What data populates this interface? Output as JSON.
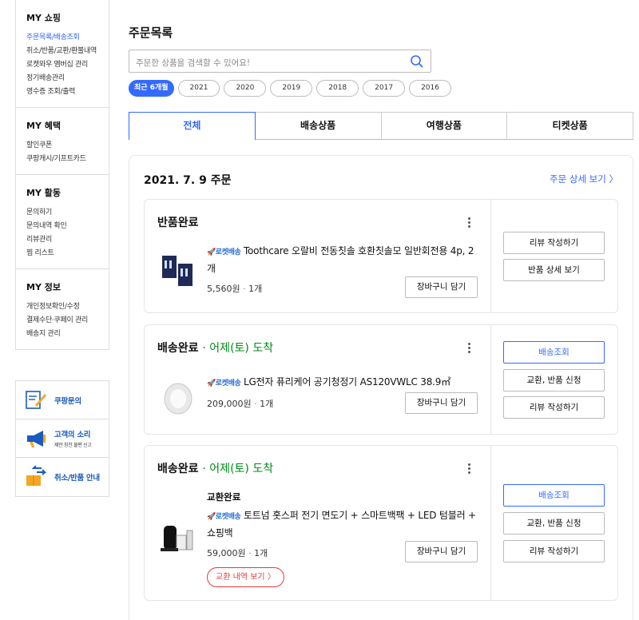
{
  "sidebar": {
    "sections": [
      {
        "title": "MY 쇼핑",
        "items": [
          "주문목록/배송조회",
          "취소/반품/교환/환불내역",
          "로켓와우 멤버십 관리",
          "정기배송관리",
          "영수증 조회/출력"
        ]
      },
      {
        "title": "MY 혜택",
        "items": [
          "할인쿠폰",
          "쿠팡캐시/기프트카드"
        ]
      },
      {
        "title": "MY 활동",
        "items": [
          "문의하기",
          "문의내역 확인",
          "리뷰관리",
          "찜 리스트"
        ]
      },
      {
        "title": "MY 정보",
        "items": [
          "개인정보확인/수정",
          "결제수단·쿠페이 관리",
          "배송지 관리"
        ]
      }
    ],
    "cards": [
      {
        "title": "쿠팡문의",
        "subtitle": "",
        "icon": "inquiry-icon"
      },
      {
        "title": "고객의 소리",
        "subtitle": "제안 칭찬 불편 신고",
        "icon": "megaphone-icon"
      },
      {
        "title": "취소/반품 안내",
        "subtitle": "",
        "icon": "box-return-icon"
      }
    ]
  },
  "main": {
    "title": "주문목록",
    "search_placeholder": "주문한 상품을 검색할 수 있어요!",
    "years": [
      "최근 6개월",
      "2021",
      "2020",
      "2019",
      "2018",
      "2017",
      "2016"
    ],
    "tabs": [
      "전체",
      "배송상품",
      "여행상품",
      "티켓상품"
    ],
    "order": {
      "date": "2021. 7. 9 주문",
      "detail_link": "주문 상세 보기 〉",
      "rocket_label": "🚀로켓배송",
      "cart_label": "장바구니 담기",
      "items": [
        {
          "status": "반품완료",
          "status_sub": "",
          "name": "Toothcare 오랄비 전동칫솔 호환칫솔모 일반회전용 4p, 2개",
          "price": "5,560원",
          "qty": "1개",
          "buttons": [
            "리뷰 작성하기",
            "반품 상세 보기"
          ]
        },
        {
          "status": "배송완료",
          "status_sub": "· 어제(토) 도착",
          "name": "LG전자 퓨리케어 공기청정기 AS120VWLC 38.9㎡",
          "price": "209,000원",
          "qty": "1개",
          "buttons": [
            "배송조회",
            "교환, 반품 신청",
            "리뷰 작성하기"
          ]
        },
        {
          "status": "배송완료",
          "status_sub": "· 어제(토) 도착",
          "exchange_label": "교환완료",
          "name": "토트넘 홋스퍼 전기 면도기 + 스마트백팩 + LED 텀블러 + 쇼핑백",
          "price": "59,000원",
          "qty": "1개",
          "exchange_btn": "교환 내역 보기 〉",
          "buttons": [
            "배송조회",
            "교환, 반품 신청",
            "리뷰 작성하기"
          ]
        }
      ]
    }
  },
  "colors": {
    "accent": "#346aff",
    "delivered": "#00891a",
    "exchange": "#e53939"
  }
}
